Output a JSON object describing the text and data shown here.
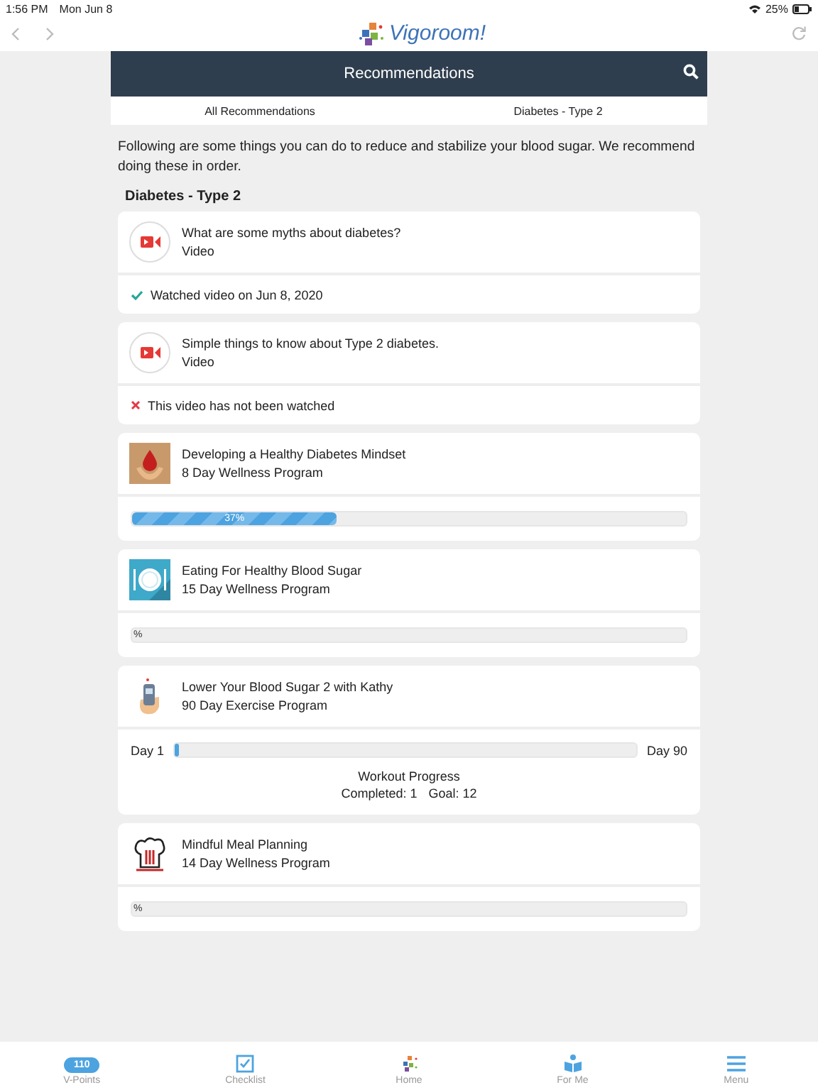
{
  "status_bar": {
    "time": "1:56 PM",
    "date": "Mon Jun 8",
    "battery": "25%"
  },
  "browser": {
    "logo": "Vigoroom!"
  },
  "header": {
    "title": "Recommendations"
  },
  "tabs": [
    {
      "label": "All Recommendations",
      "selected": false
    },
    {
      "label": "Diabetes - Type 2",
      "selected": false
    }
  ],
  "intro": "Following are some things you can do to reduce and stabilize your blood sugar. We recommend doing these in order.",
  "section_title": "Diabetes - Type 2",
  "cards": [
    {
      "kind": "video",
      "title": "What are some myths about diabetes?",
      "subtitle": "Video",
      "watched": true,
      "status": "Watched video on Jun 8, 2020"
    },
    {
      "kind": "video",
      "title": "Simple things to know about Type 2 diabetes.",
      "subtitle": "Video",
      "watched": false,
      "status": "This video has not been watched"
    },
    {
      "kind": "program",
      "title": "Developing a Healthy Diabetes Mindset",
      "subtitle": "8 Day Wellness Program",
      "level": 0.37,
      "reading": "37%"
    },
    {
      "kind": "program",
      "title": "Eating For Healthy Blood Sugar",
      "subtitle": "15 Day Wellness Program",
      "level": 0,
      "reading": "%"
    },
    {
      "kind": "exercise",
      "title": "Lower Your Blood Sugar 2 with Kathy",
      "subtitle": "90 Day Exercise Program",
      "start": "Day 1",
      "end": "Day 90",
      "level": 0.01,
      "progress_title": "Workout Progress",
      "completed": "Completed: 1",
      "goal": "Goal: 12"
    },
    {
      "kind": "program",
      "title": "Mindful Meal Planning",
      "subtitle": "14 Day Wellness Program",
      "level": 0,
      "reading": "%"
    }
  ],
  "tab_bar": [
    {
      "kind": "points",
      "label": "V-Points",
      "badge": "110"
    },
    {
      "kind": "checklist",
      "label": "Checklist"
    },
    {
      "kind": "home",
      "label": "Home"
    },
    {
      "kind": "forme",
      "label": "For Me"
    },
    {
      "kind": "menu",
      "label": "Menu"
    }
  ]
}
